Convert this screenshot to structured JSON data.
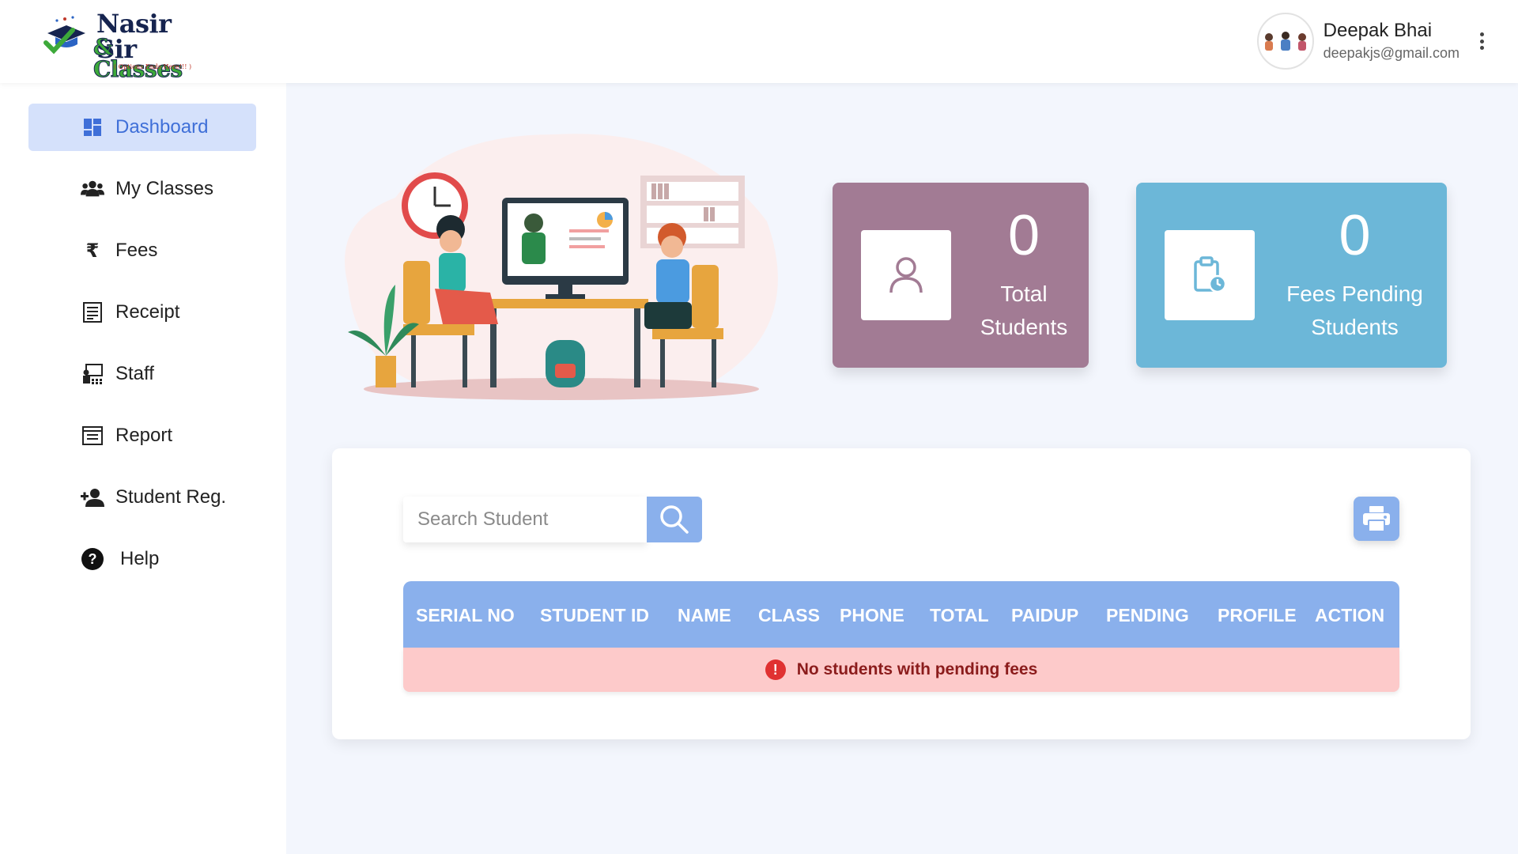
{
  "brand": {
    "name_line1": "Nasir Sir",
    "name_line2": "& Classes",
    "tagline": "( Options Ends Here!!! )"
  },
  "user": {
    "name": "Deepak Bhai",
    "email": "deepakjs@gmail.com"
  },
  "sidebar": {
    "items": [
      {
        "label": "Dashboard",
        "icon": "dashboard-icon",
        "active": true
      },
      {
        "label": "My Classes",
        "icon": "users-icon"
      },
      {
        "label": "Fees",
        "icon": "rupee-icon"
      },
      {
        "label": "Receipt",
        "icon": "receipt-icon"
      },
      {
        "label": "Staff",
        "icon": "staff-icon"
      },
      {
        "label": "Report",
        "icon": "report-icon"
      },
      {
        "label": "Student Reg.",
        "icon": "add-user-icon"
      },
      {
        "label": "Help",
        "icon": "help-icon"
      }
    ]
  },
  "stats": {
    "total_students": {
      "value": "0",
      "label_line1": "Total",
      "label_line2": "Students",
      "color": "#a27b94"
    },
    "fees_pending": {
      "value": "0",
      "label_line1": "Fees Pending",
      "label_line2": "Students",
      "color": "#6cb7d8"
    }
  },
  "search": {
    "placeholder": "Search Student"
  },
  "table": {
    "columns": [
      "SERIAL NO",
      "STUDENT ID",
      "NAME",
      "CLASS",
      "PHONE",
      "TOTAL",
      "PAIDUP",
      "PENDING",
      "PROFILE",
      "ACTION"
    ],
    "empty_message": "No students with pending fees"
  },
  "colors": {
    "accent": "#8ab0ec",
    "active_nav_bg": "#d5e1fb",
    "active_nav_text": "#3f6fd8",
    "error_bg": "#fdcaca"
  }
}
